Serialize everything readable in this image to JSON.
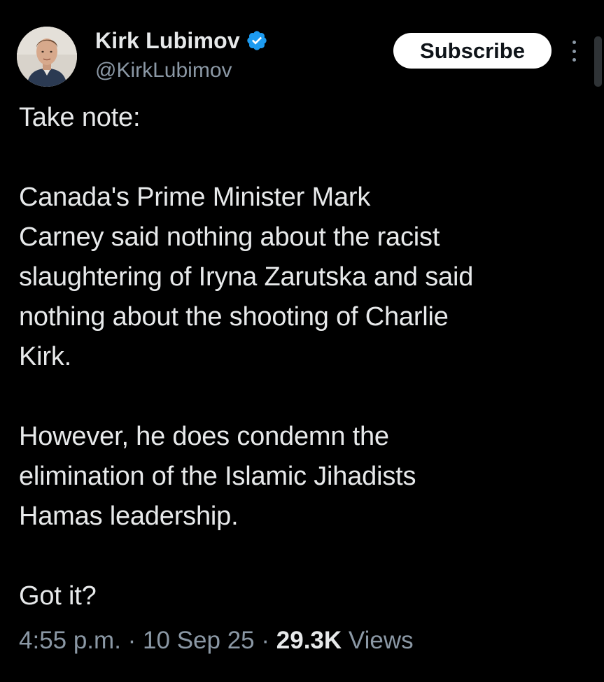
{
  "author": {
    "display_name": "Kirk Lubimov",
    "handle": "@KirkLubimov",
    "verified_icon": "verified-badge-icon",
    "accent_color": "#1d9bf0"
  },
  "actions": {
    "subscribe_label": "Subscribe",
    "more_icon": "more-vertical-icon"
  },
  "tweet": {
    "paragraphs": [
      "Take note:",
      "Canada's Prime Minister Mark\nCarney said nothing about the racist\nslaughtering of Iryna Zarutska and said\nnothing about the shooting of Charlie\nKirk.",
      "However, he does condemn the\nelimination of the Islamic Jihadists\nHamas leadership.",
      "Got it?"
    ]
  },
  "meta": {
    "time": "4:55 p.m.",
    "separator": "·",
    "date": "10 Sep 25",
    "views_count": "29.3K",
    "views_label": "Views"
  },
  "colors": {
    "background": "#000000",
    "text_primary": "#e7e9ea",
    "text_secondary": "#8b98a5",
    "button_bg": "#ffffff"
  }
}
